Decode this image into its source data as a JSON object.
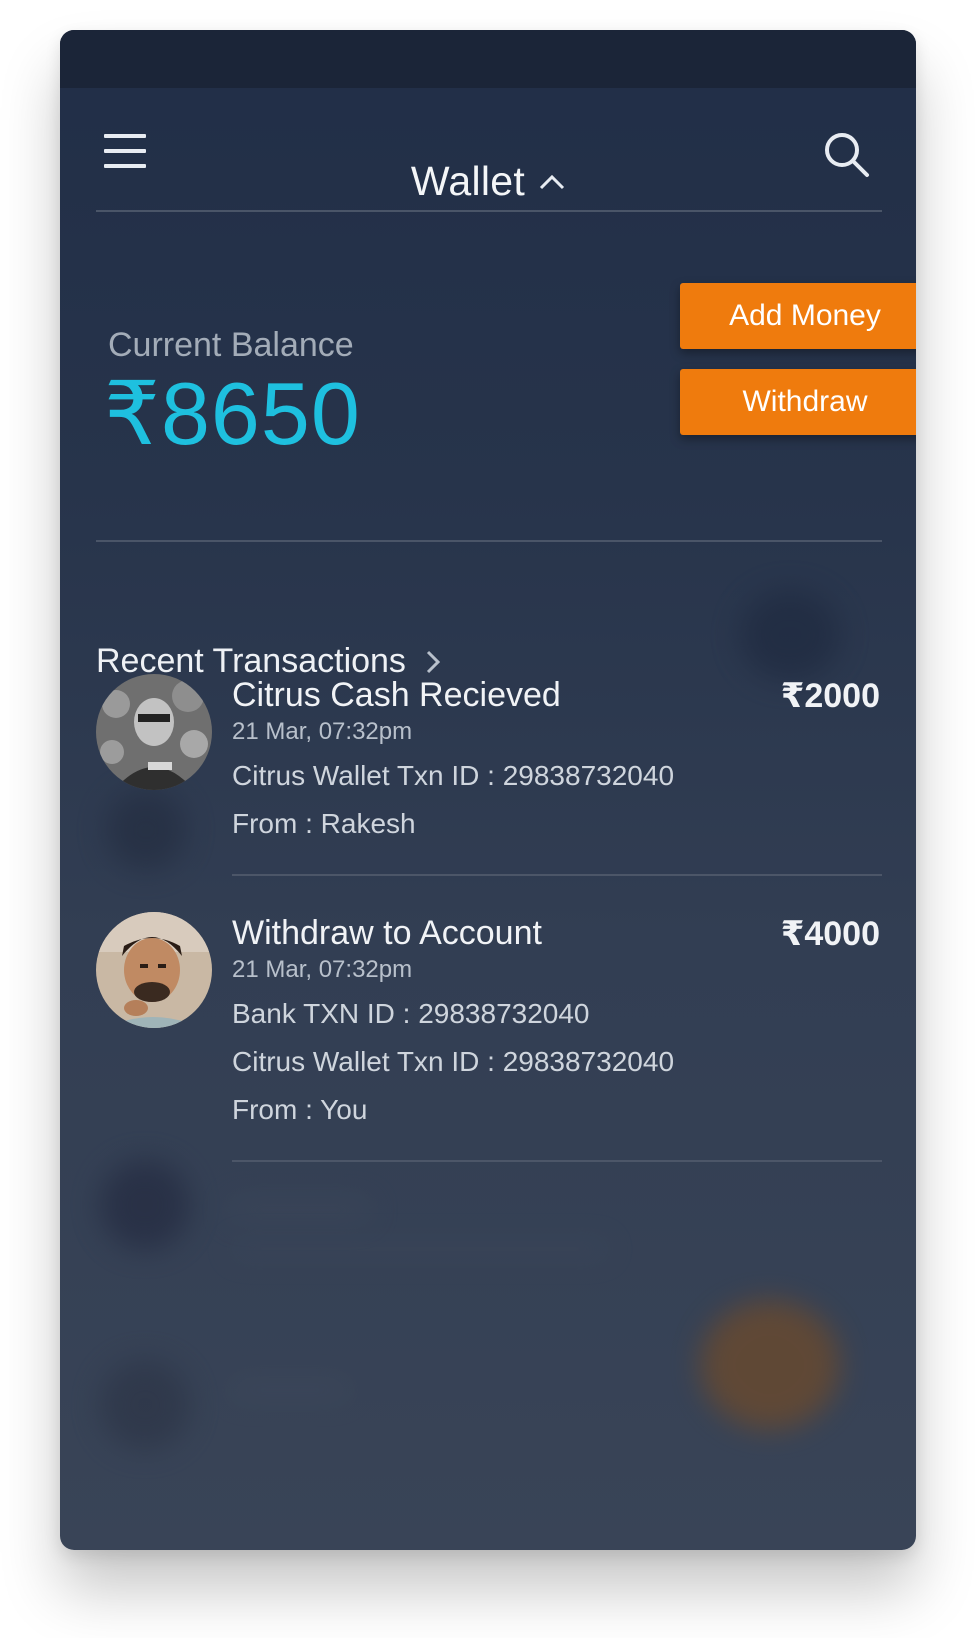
{
  "header": {
    "title": "Wallet",
    "menu_icon": "hamburger-menu-icon",
    "title_icon": "chevron-up-icon",
    "search_icon": "search-icon"
  },
  "balance": {
    "label": "Current Balance",
    "amount": "₹8650",
    "add_money_label": "Add Money",
    "withdraw_label": "Withdraw"
  },
  "transactions": {
    "section_title": "Recent Transactions",
    "section_icon": "chevron-right-icon",
    "items": [
      {
        "title": "Citrus Cash Recieved",
        "amount": "₹2000",
        "date": "21 Mar, 07:32pm",
        "lines": [
          "Citrus Wallet Txn ID : 29838732040",
          "From : Rakesh"
        ]
      },
      {
        "title": "Withdraw to Account",
        "amount": "₹4000",
        "date": "21 Mar, 07:32pm",
        "lines": [
          "Bank TXN ID : 29838732040",
          "Citrus Wallet Txn ID : 29838732040",
          "From : You"
        ]
      }
    ]
  },
  "colors": {
    "accent_orange": "#ef7b0d",
    "balance_cyan": "#1ec0df",
    "background_top": "#212e47",
    "background_bottom": "#394457"
  }
}
